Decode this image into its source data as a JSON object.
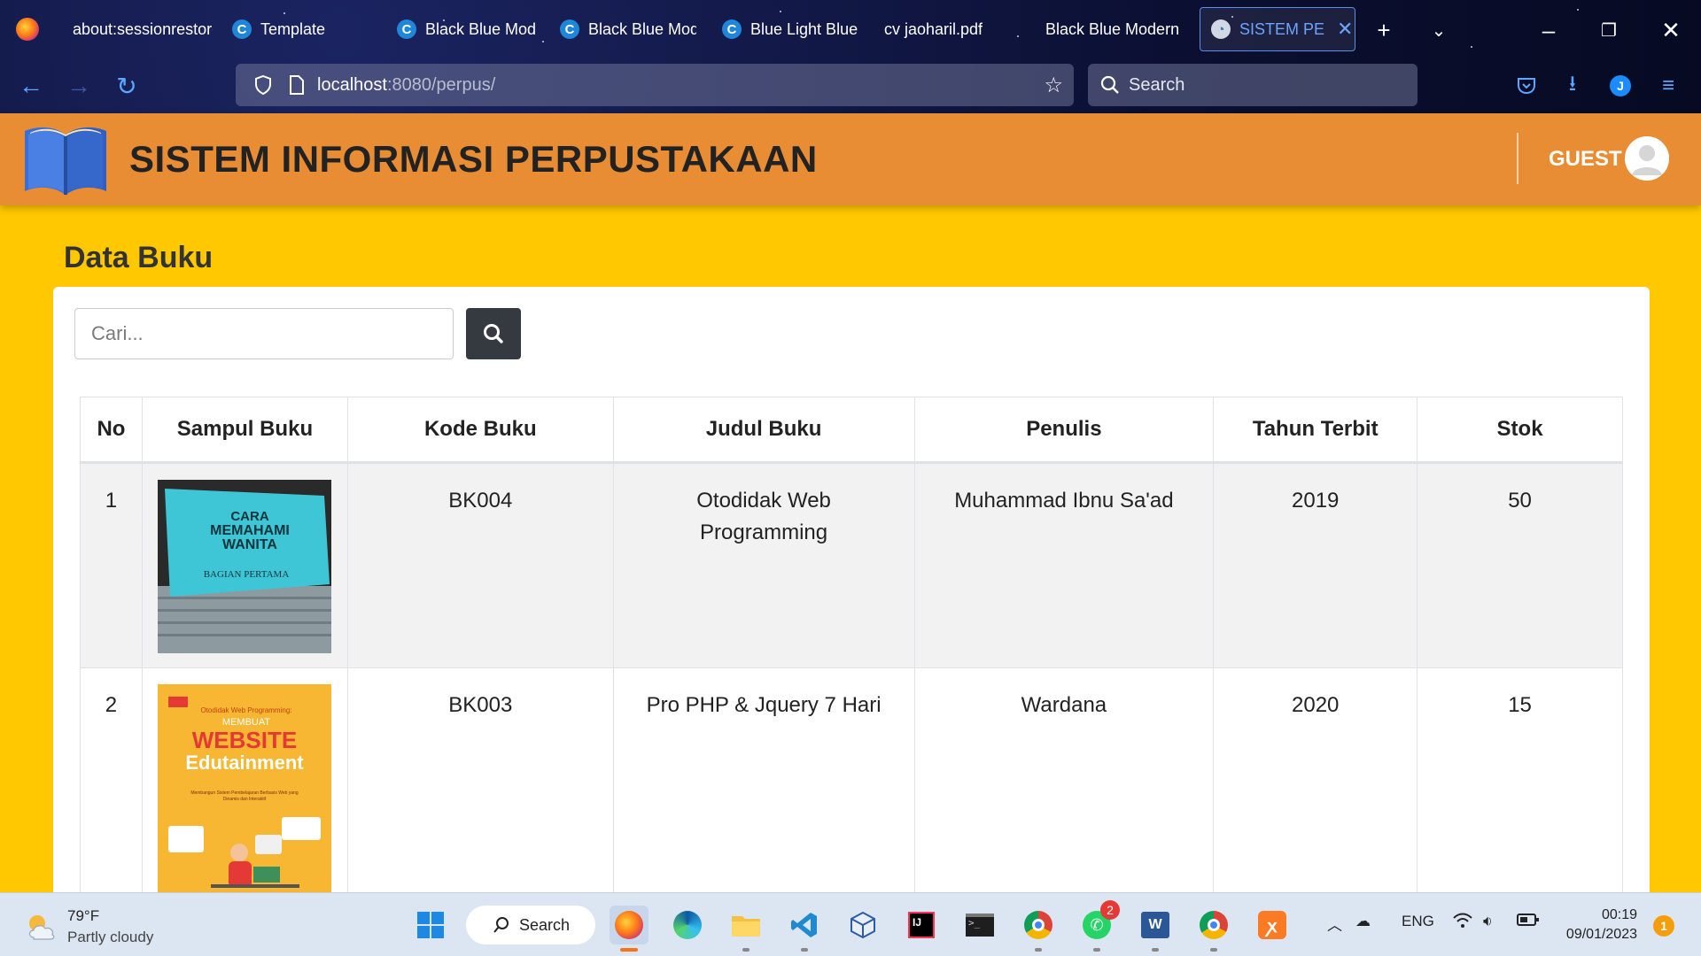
{
  "browser": {
    "tabs": [
      {
        "label": "about:sessionrestore",
        "icon": "firefox-icon"
      },
      {
        "label": "Template",
        "icon": "canva-icon"
      },
      {
        "label": "Black Blue Modern",
        "icon": "canva-icon"
      },
      {
        "label": "Black Blue Modern",
        "icon": "canva-icon"
      },
      {
        "label": "Blue Light Blue",
        "icon": "canva-icon"
      },
      {
        "label": "cv jaoharil.pdf",
        "icon": "pdf-icon"
      },
      {
        "label": "Black Blue Modern",
        "icon": "canva-icon"
      },
      {
        "label": "SISTEM PERPUSTAKAAN",
        "icon": "app-icon"
      }
    ],
    "url_host": "localhost",
    "url_rest": ":8080/perpus/",
    "search_placeholder": "Search",
    "profile_initial": "J"
  },
  "app": {
    "title": "SISTEM INFORMASI PERPUSTAKAAN",
    "user_label": "GUEST"
  },
  "page": {
    "heading": "Data Buku",
    "search_placeholder": "Cari..."
  },
  "table": {
    "headers": [
      "No",
      "Sampul Buku",
      "Kode Buku",
      "Judul Buku",
      "Penulis",
      "Tahun Terbit",
      "Stok"
    ],
    "rows": [
      {
        "no": "1",
        "kode": "BK004",
        "judul": "Otodidak Web Programming",
        "penulis": "Muhammad Ibnu Sa'ad",
        "tahun": "2019",
        "stok": "50",
        "cover": {
          "line1": "CARA",
          "line2": "MEMAHAMI",
          "line3": "WANITA",
          "line4": "BAGIAN PERTAMA"
        }
      },
      {
        "no": "2",
        "kode": "BK003",
        "judul": "Pro PHP & Jquery 7 Hari",
        "penulis": "Wardana",
        "tahun": "2020",
        "stok": "15",
        "cover": {
          "line1": "Otodidak Web Programming:",
          "line2": "MEMBUAT",
          "line3": "WEBSITE",
          "line4": "Edutainment",
          "line5": "Membangun Sistem Pembelajaran Berbasis Web yang Dinamis dan Interaktif"
        }
      }
    ]
  },
  "taskbar": {
    "weather_temp": "79°F",
    "weather_desc": "Partly cloudy",
    "search_label": "Search",
    "lang": "ENG",
    "time": "00:19",
    "date": "09/01/2023",
    "whatsapp_badge": "2",
    "notification_count": "1"
  },
  "colors": {
    "page_bg": "#ffc800",
    "header_bg": "#e98d35",
    "search_button": "#343a40"
  }
}
